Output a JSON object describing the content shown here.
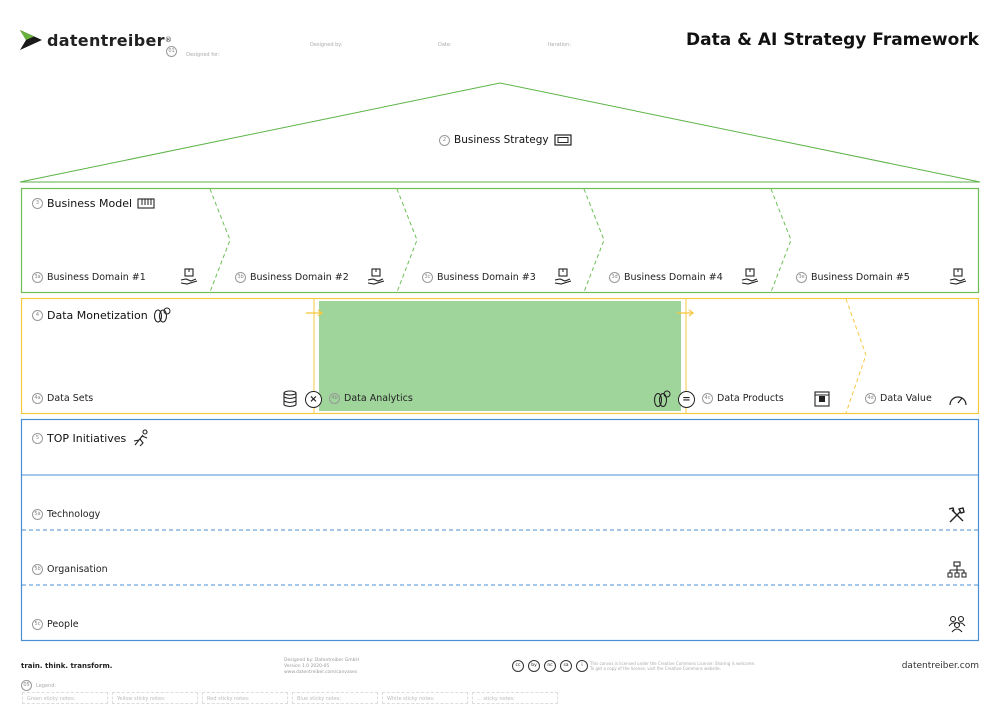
{
  "brand": {
    "name": "datentreiber",
    "trademark": "®",
    "url": "datentreiber.com",
    "tagline": "train. think. transform.",
    "accent": "#69b23b"
  },
  "header": {
    "title": "Data & AI Strategy Framework",
    "meta": [
      {
        "num": "01",
        "label": "Designed for:"
      },
      {
        "label": "Designed by:"
      },
      {
        "label": "Date:"
      },
      {
        "label": "Iteration:"
      }
    ]
  },
  "strategy": {
    "num": "2",
    "label": "Business Strategy",
    "icon": "strategy-board-icon",
    "color": "#5cb348"
  },
  "business_model": {
    "num": "3",
    "label": "Business Model",
    "icon": "keyboard-icon",
    "color": "#6dbf57",
    "domains": [
      {
        "num": "3a",
        "label": "Business Domain #1"
      },
      {
        "num": "3b",
        "label": "Business Domain #2"
      },
      {
        "num": "3c",
        "label": "Business Domain #3"
      },
      {
        "num": "3d",
        "label": "Business Domain #4"
      },
      {
        "num": "3e",
        "label": "Business Domain #5"
      }
    ]
  },
  "data_monetization": {
    "num": "4",
    "label": "Data Monetization",
    "icon": "coins-icon",
    "color": "#f5c842",
    "highlight": "#9fd49b",
    "items": [
      {
        "num": "4a",
        "label": "Data Sets",
        "icon": "database-icon"
      },
      {
        "num": "4b",
        "label": "Data Analytics",
        "icon": "coins-icon"
      },
      {
        "num": "4c",
        "label": "Data Products",
        "icon": "product-box-icon"
      },
      {
        "num": "4d",
        "label": "Data Value",
        "icon": "gauge-icon"
      }
    ],
    "operators": [
      "×",
      "="
    ]
  },
  "initiatives": {
    "num": "5",
    "label": "TOP Initiatives",
    "icon": "runner-icon",
    "color": "#4a8fd6",
    "rows": [
      {
        "num": "5a",
        "label": "Technology",
        "icon": "tools-icon"
      },
      {
        "num": "5b",
        "label": "Organisation",
        "icon": "org-chart-icon"
      },
      {
        "num": "5c",
        "label": "People",
        "icon": "people-icon"
      }
    ]
  },
  "footer": {
    "design_credit": [
      "Designed by: Datentreiber GmbH",
      "Version 1.0 2020-05",
      "www.datentreiber.com/canvases"
    ],
    "license_icons": [
      "cc",
      "by",
      "nc",
      "sa",
      "i"
    ],
    "license_text": [
      "This canvas is licensed under the Creative Commons License: Sharing is welcome.",
      "To get a copy of the license, visit the Creative Commons website."
    ],
    "legend_num": "05",
    "legend_label": "Legend:",
    "stickies": [
      "Green sticky notes:",
      "Yellow sticky notes:",
      "Red sticky notes:",
      "Blue sticky notes:",
      "White sticky notes:",
      "... sticky notes:"
    ]
  }
}
